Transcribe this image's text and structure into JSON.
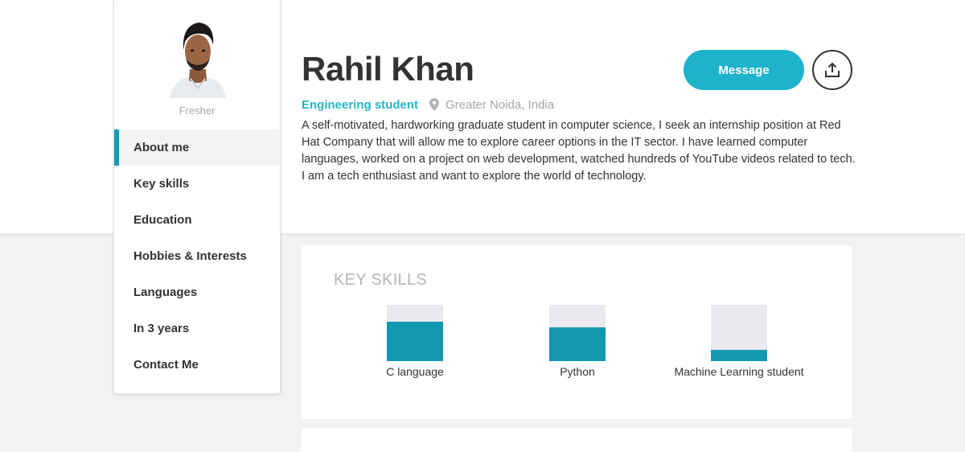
{
  "profile": {
    "name": "Rahil Khan",
    "level": "Fresher",
    "role": "Engineering student",
    "location": "Greater Noida, India",
    "bio": "A self-motivated, hardworking graduate student in computer science, I seek an internship position at Red Hat Company that will allow me to explore career options in the IT sector. I have learned computer languages, worked on a project on web development, watched hundreds of YouTube videos related to tech. I am a tech enthusiast and want to explore the world of technology."
  },
  "actions": {
    "message_label": "Message",
    "share_icon": "share-upload-icon"
  },
  "sidebar": {
    "items": [
      {
        "label": "About me",
        "active": true
      },
      {
        "label": "Key skills",
        "active": false
      },
      {
        "label": "Education",
        "active": false
      },
      {
        "label": "Hobbies & Interests",
        "active": false
      },
      {
        "label": "Languages",
        "active": false
      },
      {
        "label": "In 3 years",
        "active": false
      },
      {
        "label": "Contact Me",
        "active": false
      }
    ]
  },
  "skills": {
    "title": "KEY SKILLS",
    "items": [
      {
        "label": "C language",
        "level": 0.7
      },
      {
        "label": "Python",
        "level": 0.6
      },
      {
        "label": "Machine Learning student",
        "level": 0.2
      }
    ]
  },
  "colors": {
    "accent": "#1299b1",
    "button": "#1eb3cc",
    "role_text": "#2ab3c9",
    "skill_track": "#e9eaed"
  }
}
